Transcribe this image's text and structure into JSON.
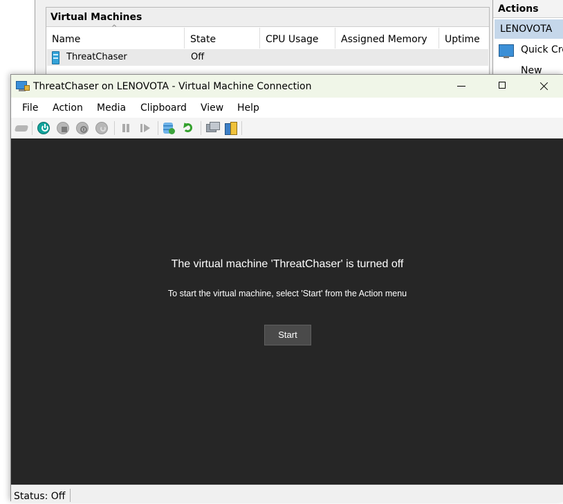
{
  "manager": {
    "vm_panel_title": "Virtual Machines",
    "columns": [
      "Name",
      "State",
      "CPU Usage",
      "Assigned Memory",
      "Uptime"
    ],
    "rows": [
      {
        "name": "ThreatChaser",
        "state": "Off"
      }
    ],
    "actions": {
      "title": "Actions",
      "host": "LENOVOTA",
      "items": [
        "Quick Cre",
        "New"
      ]
    }
  },
  "vmc": {
    "title": "ThreatChaser on LENOVOTA - Virtual Machine Connection",
    "menu": [
      "File",
      "Action",
      "Media",
      "Clipboard",
      "View",
      "Help"
    ],
    "toolbar_icons": [
      "ctrl-alt-del-icon",
      "start-icon",
      "turn-off-icon",
      "shut-down-icon",
      "save-icon",
      "pause-icon",
      "reset-icon",
      "checkpoint-icon",
      "revert-icon",
      "enhanced-session-icon",
      "share-icon"
    ],
    "screen": {
      "heading": "The virtual machine 'ThreatChaser' is turned off",
      "message": "To start the virtual machine, select 'Start' from the Action menu",
      "start_label": "Start"
    },
    "status": "Status: Off"
  }
}
